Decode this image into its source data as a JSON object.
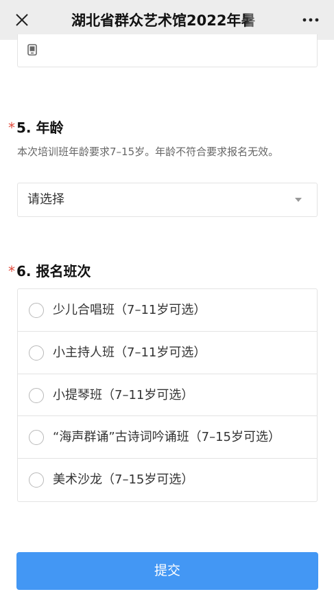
{
  "nav": {
    "title": "湖北省群众艺术馆2022年暑",
    "close_icon": "close-icon",
    "more_icon": "more-icon"
  },
  "phone_field": {
    "icon": "phone-icon"
  },
  "q5": {
    "required_mark": "*",
    "title": "5. 年龄",
    "description": "本次培训班年龄要求7–15岁。年龄不符合要求报名无效。",
    "select_value": "请选择"
  },
  "q6": {
    "required_mark": "*",
    "title": "6. 报名班次",
    "options": [
      {
        "label": "少儿合唱班（7–11岁可选）"
      },
      {
        "label": "小主持人班（7–11岁可选）"
      },
      {
        "label": "小提琴班（7–11岁可选）"
      },
      {
        "label": "“海声群诵”古诗词吟诵班（7–15岁可选）"
      },
      {
        "label": "美术沙龙（7–15岁可选）"
      }
    ]
  },
  "submit_label": "提交",
  "colors": {
    "accent": "#4397f4",
    "required": "#e04a3c"
  }
}
